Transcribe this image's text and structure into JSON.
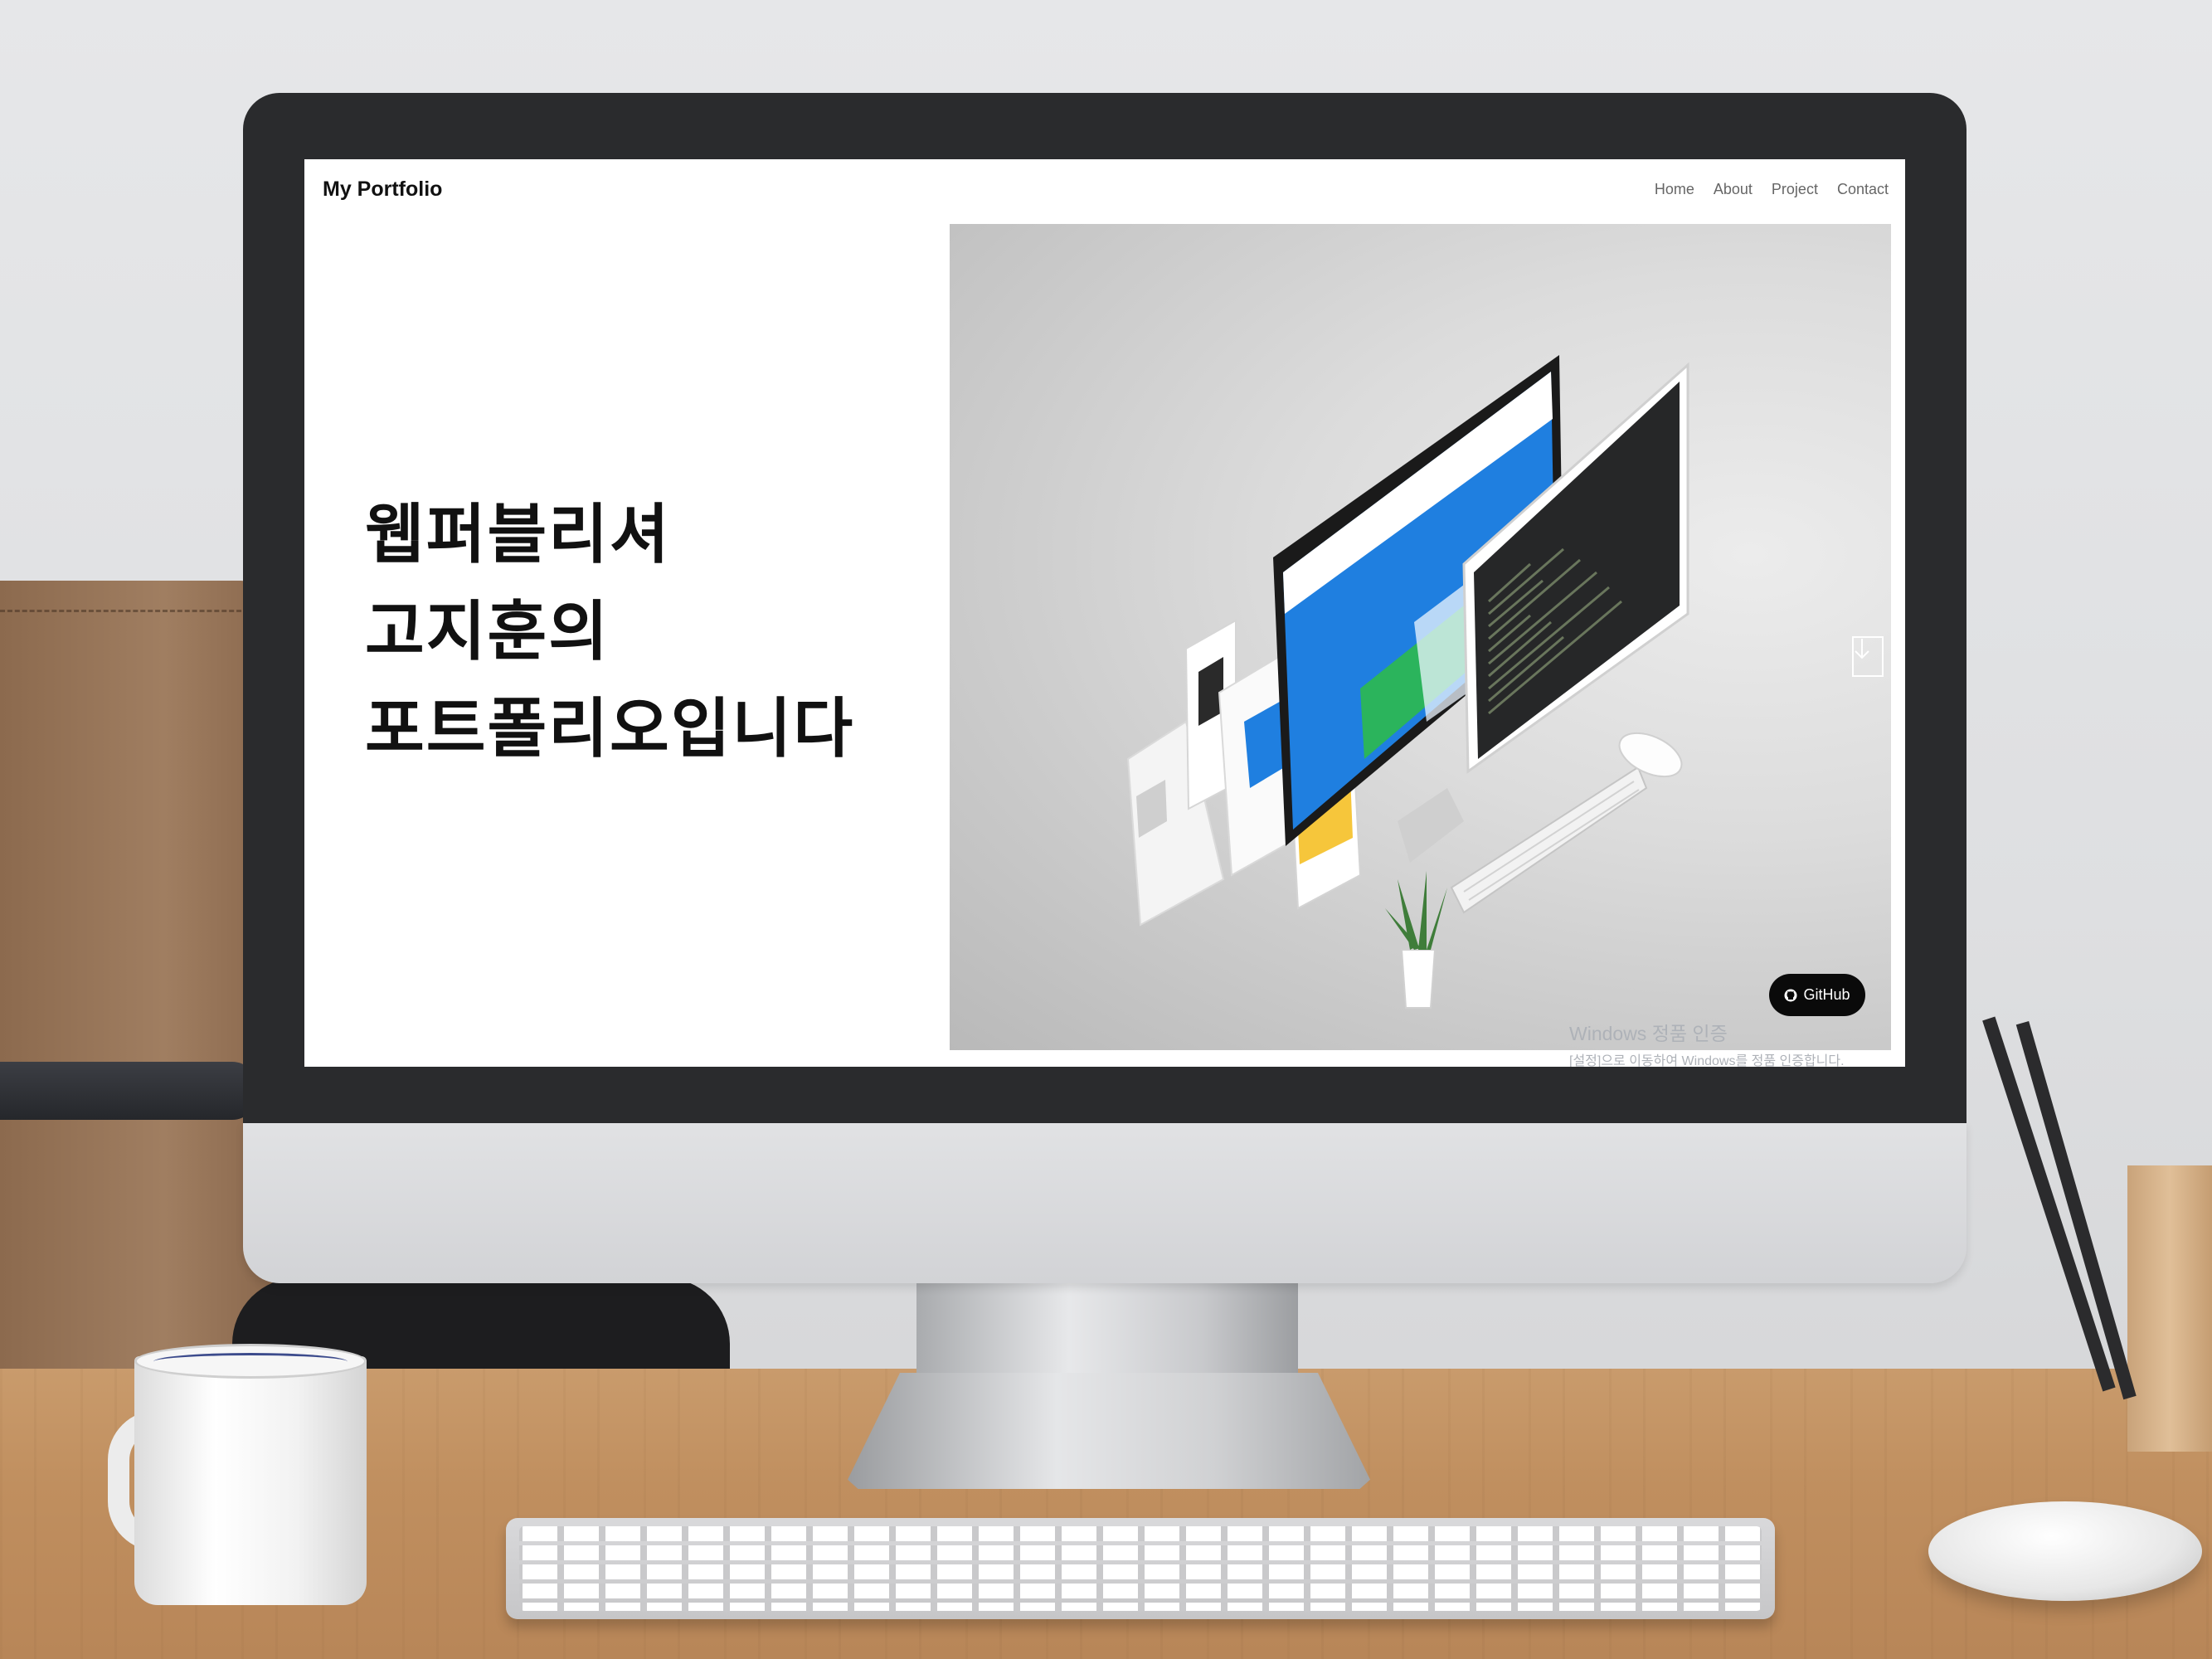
{
  "site": {
    "brand": "My Portfolio",
    "nav": [
      "Home",
      "About",
      "Project",
      "Contact"
    ],
    "headline": [
      "웹퍼블리셔",
      "고지훈의",
      "포트폴리오입니다"
    ],
    "hero": {
      "image": "isometric-devices-mockup",
      "scroll_icon": "arrow-down-icon"
    },
    "github": {
      "label": "GitHub",
      "icon": "github-icon"
    }
  },
  "windows_watermark": {
    "title": "Windows 정품 인증",
    "subtitle": "[설정]으로 이동하여 Windows를 정품 인증합니다."
  },
  "colors": {
    "screen_bg": "#ffffff",
    "bezel": "#2a2b2d",
    "text": "#111111",
    "nav_text": "#666666",
    "github_bg": "#0a0a0a",
    "mockup_blue": "#1f7fe0"
  }
}
